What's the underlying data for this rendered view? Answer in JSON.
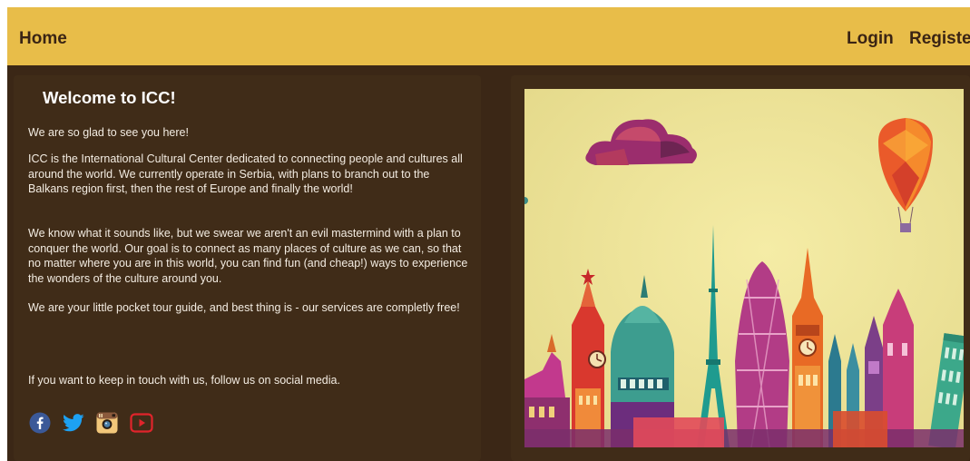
{
  "navbar": {
    "home_label": "Home",
    "login_label": "Login",
    "register_label": "Register"
  },
  "welcome": {
    "title": "Welcome to ICC!",
    "paragraphs": [
      "We are so glad to see you here!",
      "ICC is the International Cultural Center dedicated to connecting people and cultures all around the world. We currently operate in Serbia, with plans to branch out to the Balkans region first, then the rest of Europe and finally the world!",
      "We know what it sounds like, but we swear we aren't an evil mastermind with a plan to conquer the world. Our goal is to connect as many places of culture as we can, so that no matter where you are in this world, you can find fun (and cheap!) ways to experience the wonders of the culture around you.",
      "We are your little pocket tour guide, and best thing is - our services are completly free!",
      "If you want to keep in touch with us, follow us on social media."
    ]
  },
  "social_icons": [
    "facebook-icon",
    "twitter-icon",
    "instagram-icon",
    "youtube-icon"
  ],
  "colors": {
    "navbar": "#e8bd49",
    "page_bg": "#3b2716",
    "panel_bg": "#402c18",
    "nav_text": "#3a2414",
    "body_text": "#f3ece2"
  }
}
